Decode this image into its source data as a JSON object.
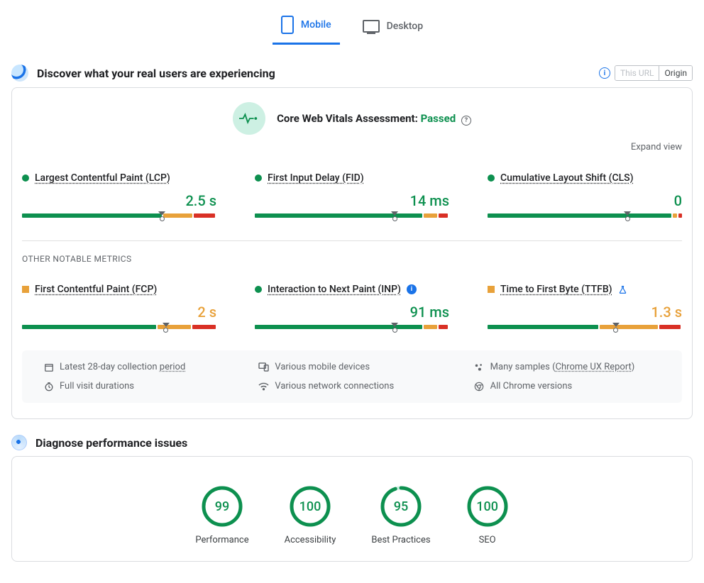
{
  "tabs": {
    "mobile": "Mobile",
    "desktop": "Desktop"
  },
  "section1": {
    "title": "Discover what your real users are experiencing",
    "pill_this_url": "This URL",
    "pill_origin": "Origin"
  },
  "assessment": {
    "label": "Core Web Vitals Assessment:",
    "status": "Passed"
  },
  "expand": "Expand view",
  "metrics": {
    "lcp": {
      "label": "Largest Contentful Paint (LCP)",
      "value": "2.5 s"
    },
    "fid": {
      "label": "First Input Delay (FID)",
      "value": "14 ms"
    },
    "cls": {
      "label": "Cumulative Layout Shift (CLS)",
      "value": "0"
    },
    "fcp": {
      "label": "First Contentful Paint (FCP)",
      "value": "2 s"
    },
    "inp": {
      "label": "Interaction to Next Paint (INP)",
      "value": "91 ms"
    },
    "ttfb": {
      "label": "Time to First Byte (TTFB)",
      "value": "1.3 s"
    }
  },
  "other_metrics_label": "OTHER NOTABLE METRICS",
  "meta": {
    "period_prefix": "Latest 28-day collection ",
    "period_link": "period",
    "devices": "Various mobile devices",
    "samples_prefix": "Many samples (",
    "samples_link": "Chrome UX Report",
    "samples_suffix": ")",
    "durations": "Full visit durations",
    "network": "Various network connections",
    "versions": "All Chrome versions"
  },
  "section2": {
    "title": "Diagnose performance issues"
  },
  "gauges": {
    "performance": {
      "score": "99",
      "label": "Performance"
    },
    "accessibility": {
      "score": "100",
      "label": "Accessibility"
    },
    "best_practices": {
      "score": "95",
      "label": "Best Practices"
    },
    "seo": {
      "score": "100",
      "label": "SEO"
    }
  }
}
